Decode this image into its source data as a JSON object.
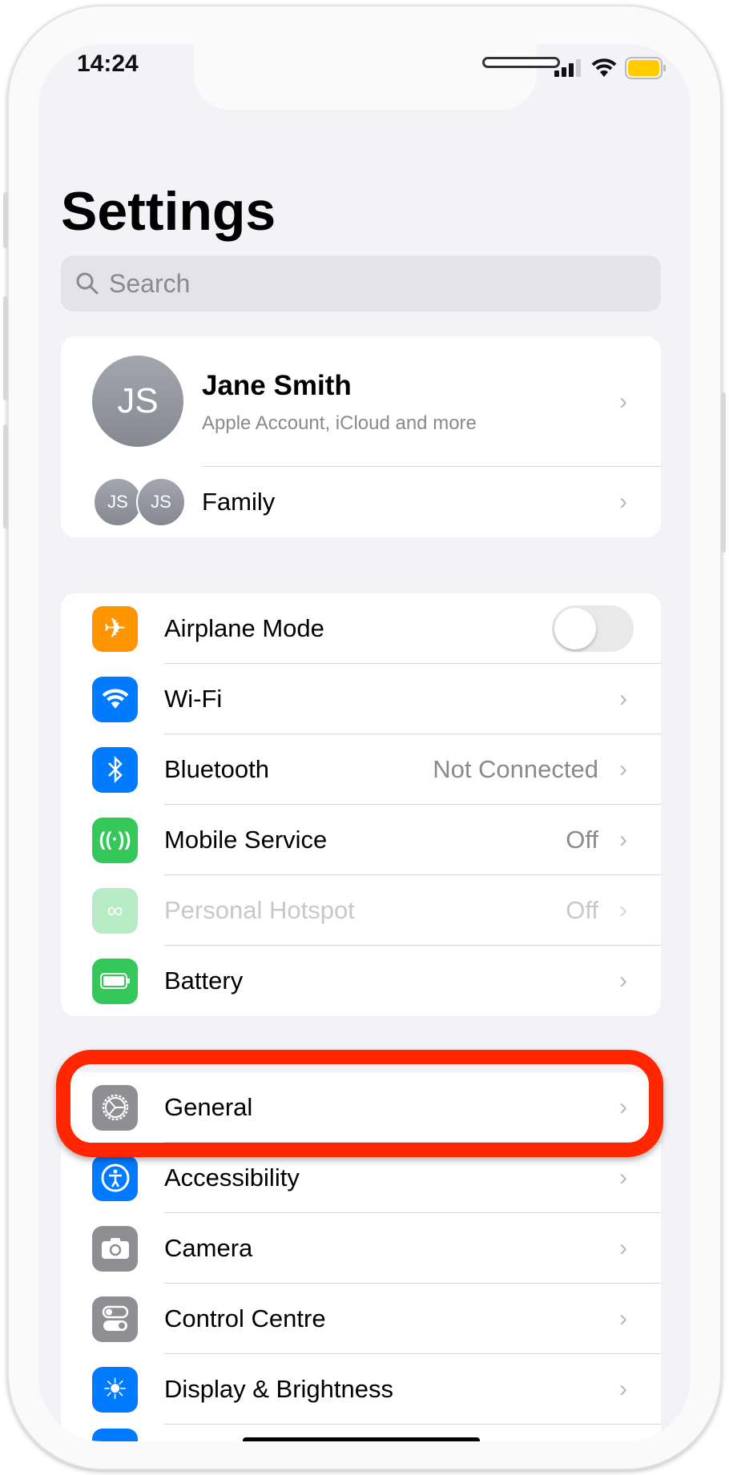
{
  "status_bar": {
    "time": "14:24",
    "battery_color": "#ffcc00"
  },
  "header": {
    "title": "Settings"
  },
  "search": {
    "placeholder": "Search",
    "icon": "search-icon"
  },
  "profile": {
    "initials": "JS",
    "name": "Jane Smith",
    "subtitle": "Apple Account, iCloud and more",
    "family_label": "Family",
    "family_initials": [
      "JS",
      "JS"
    ]
  },
  "connectivity": [
    {
      "label": "Airplane Mode",
      "icon": "airplane-icon",
      "color": "#ff9500",
      "toggle": false
    },
    {
      "label": "Wi-Fi",
      "icon": "wifi-icon",
      "color": "#007aff",
      "value": ""
    },
    {
      "label": "Bluetooth",
      "icon": "bluetooth-icon",
      "color": "#007aff",
      "value": "Not Connected"
    },
    {
      "label": "Mobile Service",
      "icon": "antenna-icon",
      "color": "#34c759",
      "value": "Off"
    },
    {
      "label": "Personal Hotspot",
      "icon": "hotspot-icon",
      "color": "#34c759",
      "value": "Off",
      "disabled": true
    },
    {
      "label": "Battery",
      "icon": "battery-icon",
      "color": "#34c759",
      "value": ""
    }
  ],
  "system": [
    {
      "label": "General",
      "icon": "gear-icon",
      "color": "#8e8e93",
      "highlighted": true
    },
    {
      "label": "Accessibility",
      "icon": "accessibility-icon",
      "color": "#007aff"
    },
    {
      "label": "Camera",
      "icon": "camera-icon",
      "color": "#8e8e93"
    },
    {
      "label": "Control Centre",
      "icon": "control-centre-icon",
      "color": "#8e8e93"
    },
    {
      "label": "Display & Brightness",
      "icon": "sun-icon",
      "color": "#007aff"
    }
  ],
  "highlight_color": "#ff2600"
}
